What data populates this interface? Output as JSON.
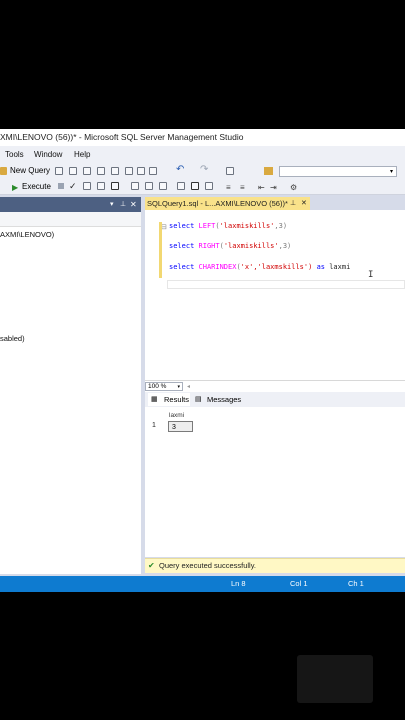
{
  "window": {
    "title": "XMI\\LENOVO (56))* - Microsoft SQL Server Management Studio"
  },
  "menu": [
    "Tools",
    "Window",
    "Help"
  ],
  "toolbar": {
    "new_query": "New Query",
    "execute": "Execute"
  },
  "object_explorer": {
    "items": [
      "AXMI\\LENOVO)",
      "sabled)"
    ]
  },
  "editor": {
    "tab_label": "SQLQuery1.sql - L...AXMI\\LENOVO (56))*",
    "lines": [
      {
        "kw": "select",
        "fn": "LEFT",
        "open": "(",
        "str": "'laxmiskills'",
        "rest": ",3)",
        "alias_kw": "",
        "alias": ""
      },
      {
        "kw": "select",
        "fn": "RIGHT",
        "open": "(",
        "str": "'laxmiskills'",
        "rest": ",3)",
        "alias_kw": "",
        "alias": ""
      },
      {
        "kw": "select",
        "fn": "CHARINDEX",
        "open": "(",
        "str": "'x'",
        "rest": ",'laxmskills')",
        "alias_kw": "as",
        "alias": "laxmi"
      }
    ],
    "zoom": "100 %"
  },
  "results": {
    "tabs": [
      "Results",
      "Messages"
    ],
    "column": "laxmi",
    "row_number": "1",
    "value": "3",
    "status_message": "Query executed successfully."
  },
  "statusbar": {
    "line": "Ln 8",
    "col": "Col 1",
    "ch": "Ch 1"
  },
  "colors": {
    "accent": "#0e7bd0",
    "tab_active": "#f9e28a",
    "panel_header": "#4d6082"
  }
}
